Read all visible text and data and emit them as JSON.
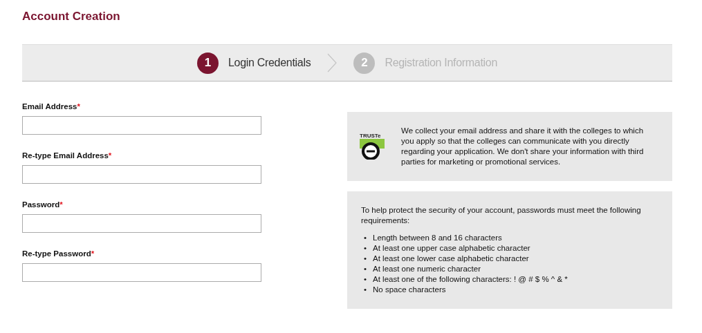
{
  "title": "Account Creation",
  "steps": [
    {
      "number": "1",
      "label": "Login Credentials",
      "selected": true
    },
    {
      "number": "2",
      "label": "Registration Information",
      "selected": false
    }
  ],
  "fields": [
    {
      "label": "Email Address",
      "required_mark": "*"
    },
    {
      "label": "Re-type Email Address",
      "required_mark": "*"
    },
    {
      "label": "Password",
      "required_mark": "*"
    },
    {
      "label": "Re-type Password",
      "required_mark": "*"
    }
  ],
  "privacy": {
    "badge": "TRUSTe",
    "text": "We collect your email address and share it with the colleges to which you apply so that the colleges can communicate with you directly regarding your application. We don't share your information with third parties for marketing or promotional services."
  },
  "requirements": {
    "intro": "To help protect the security of your account, passwords must meet the following requirements:",
    "items": [
      {
        "bullet": "•",
        "text": "Length between 8 and 16 characters"
      },
      {
        "bullet": "•",
        "text": "At least one upper case alphabetic character"
      },
      {
        "bullet": "•",
        "text": "At least one lower case alphabetic character"
      },
      {
        "bullet": "•",
        "text": "At least one numeric character"
      },
      {
        "bullet": "•",
        "text": "At least one of the following characters: ! @ # $ % ^ & *"
      },
      {
        "bullet": "•",
        "text": "No space characters"
      }
    ]
  }
}
